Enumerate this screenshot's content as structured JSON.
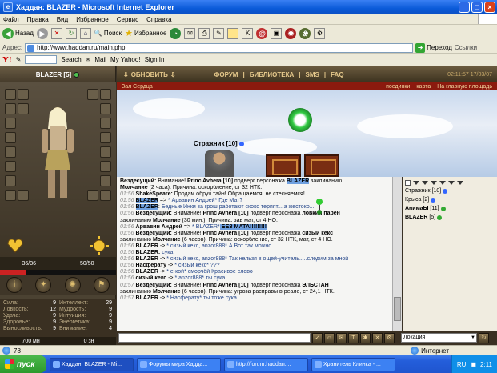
{
  "window": {
    "title": "Хаддан: BLAZER - Microsoft Internet Explorer"
  },
  "menu": [
    "Файл",
    "Правка",
    "Вид",
    "Избранное",
    "Сервис",
    "Справка"
  ],
  "toolbar": {
    "back": "Назад",
    "search": "Поиск",
    "favorites": "Избранное"
  },
  "address": {
    "label": "Адрес:",
    "url": "http://www.haddan.ru/main.php",
    "go": "Переход",
    "links": "Ссылки"
  },
  "yahoo": {
    "search": "Search",
    "mail": "Mail",
    "myyahoo": "My Yahoo!",
    "signin": "Sign In"
  },
  "game": {
    "player": {
      "name": "BLAZER [5]",
      "hp": "36/36",
      "mana": "50/50"
    },
    "nav": {
      "refresh": "ОБНОВИТЬ",
      "links": [
        "ФОРУМ",
        "БИБЛИОТЕКА",
        "SMS",
        "FAQ"
      ],
      "time": "02:11:57  17/03/07"
    },
    "location": {
      "title": "Зал Сердца",
      "links": [
        "поединки",
        "карта",
        "На главную площадь"
      ]
    },
    "enemy": {
      "name": "Стражник",
      "level": "[10]"
    },
    "stats_left": [
      {
        "label": "Сила:",
        "value": "9"
      },
      {
        "label": "Ловкость:",
        "value": "12"
      },
      {
        "label": "Удача:",
        "value": "9"
      },
      {
        "label": "Здоровье:",
        "value": "9"
      },
      {
        "label": "Выносливость:",
        "value": "9"
      }
    ],
    "stats_right": [
      {
        "label": "Интеллект:",
        "value": "29"
      },
      {
        "label": "Мудрость:",
        "value": "9"
      },
      {
        "label": "Интуиция:",
        "value": "9"
      },
      {
        "label": "Энергетика:",
        "value": "9"
      },
      {
        "label": "Внимание:",
        "value": "4"
      }
    ],
    "bottom": {
      "money": "700 мн",
      "zn": "0 зн"
    },
    "chat": [
      {
        "time": "",
        "parts": [
          {
            "c": "n",
            "t": "Вездесущий: "
          },
          {
            "c": "",
            "t": "Внимание! "
          },
          {
            "c": "n",
            "t": "Princ Avhera [10]"
          },
          {
            "c": "",
            "t": " подверг персонажа "
          },
          {
            "c": "h",
            "t": "BLAZER"
          },
          {
            "c": "",
            "t": " заклинанию"
          }
        ]
      },
      {
        "time": "",
        "parts": [
          {
            "c": "n",
            "t": "Молчание"
          },
          {
            "c": "",
            "t": " (2 часа). Причина: оскорбление, ст 32 НТК."
          }
        ]
      },
      {
        "time": "",
        "parts": [
          {
            "c": "",
            "t": " "
          }
        ]
      },
      {
        "time": "01:56",
        "parts": [
          {
            "c": "n",
            "t": "ShakeSpeare: "
          },
          {
            "c": "",
            "t": "Продам обруч тайн! Обращаемся, не стесняемся!"
          }
        ]
      },
      {
        "time": "01:56",
        "parts": [
          {
            "c": "h",
            "t": "BLAZER"
          },
          {
            "c": "",
            "t": " => "
          },
          {
            "c": "b",
            "t": "* Арвавин Андрей* Где Мат?"
          }
        ]
      },
      {
        "time": "01:56",
        "parts": [
          {
            "c": "h",
            "t": "BLAZER"
          },
          {
            "c": "",
            "t": ": "
          },
          {
            "c": "b",
            "t": "Бедные Инки за грош работают скоко терпят....а жестоко...."
          }
        ]
      },
      {
        "time": "01:56",
        "parts": [
          {
            "c": "n",
            "t": "Вездесущий: "
          },
          {
            "c": "",
            "t": "Внимание! "
          },
          {
            "c": "n",
            "t": "Princ Avhera [10]"
          },
          {
            "c": "",
            "t": " подверг персонажа "
          },
          {
            "c": "n",
            "t": "ловкий парен"
          }
        ]
      },
      {
        "time": "",
        "parts": [
          {
            "c": "",
            "t": "заклинанию "
          },
          {
            "c": "n",
            "t": "Молчание"
          },
          {
            "c": "",
            "t": " (30 мин.). Причина: зав мат, ст 4 НО."
          }
        ]
      },
      {
        "time": "01:56",
        "parts": [
          {
            "c": "n",
            "t": "Арвавин Андрей"
          },
          {
            "c": "",
            "t": " => "
          },
          {
            "c": "b",
            "t": "* BLAZER*"
          },
          {
            "c": "h",
            "t": " БЕЗ МАТА!!!!!!!!!"
          }
        ]
      },
      {
        "time": "01:56",
        "parts": [
          {
            "c": "n",
            "t": "Вездесущий: "
          },
          {
            "c": "",
            "t": "Внимание! "
          },
          {
            "c": "n",
            "t": "Princ Avhera [10]"
          },
          {
            "c": "",
            "t": " подверг персонажа "
          },
          {
            "c": "n",
            "t": "сизый кекс"
          }
        ]
      },
      {
        "time": "",
        "parts": [
          {
            "c": "",
            "t": "заклинанию "
          },
          {
            "c": "n",
            "t": "Молчание"
          },
          {
            "c": "",
            "t": " (6 часов). Причина: оскорбление, ст 32 НТК, мат, ст 4 НО."
          }
        ]
      },
      {
        "time": "01:56",
        "parts": [
          {
            "c": "n",
            "t": "BLAZER"
          },
          {
            "c": "",
            "t": " -> "
          },
          {
            "c": "b",
            "t": "* сизый кекс, anzor888* А Вот так можно"
          }
        ]
      },
      {
        "time": "01:56",
        "parts": [
          {
            "c": "n",
            "t": "BLAZER: "
          },
          {
            "c": "b",
            "t": "сука"
          }
        ]
      },
      {
        "time": "01:56",
        "parts": [
          {
            "c": "n",
            "t": "BLAZER"
          },
          {
            "c": "",
            "t": " -> "
          },
          {
            "c": "b",
            "t": "* сизый кекс, anzor888* Так нельзя в ощей-учитель.....следим за мной"
          }
        ]
      },
      {
        "time": "01:56",
        "parts": [
          {
            "c": "n",
            "t": "Насферату"
          },
          {
            "c": "",
            "t": " -> "
          },
          {
            "c": "b",
            "t": "* сизый кекс* ???"
          }
        ]
      },
      {
        "time": "01:56",
        "parts": [
          {
            "c": "n",
            "t": "BLAZER"
          },
          {
            "c": "",
            "t": " -> "
          },
          {
            "c": "b",
            "t": "* е-кой* сморчёй Красивое слово"
          }
        ]
      },
      {
        "time": "01:56",
        "parts": [
          {
            "c": "n",
            "t": "сизый кекс"
          },
          {
            "c": "",
            "t": " -> "
          },
          {
            "c": "b",
            "t": "* anzor888* ты сука"
          }
        ]
      },
      {
        "time": "01:57",
        "parts": [
          {
            "c": "n",
            "t": "Вездесущий: "
          },
          {
            "c": "",
            "t": "Внимание! "
          },
          {
            "c": "n",
            "t": "Princ Avhera [10]"
          },
          {
            "c": "",
            "t": " подверг персонажа "
          },
          {
            "c": "n",
            "t": "ЭЛЬСТАН"
          }
        ]
      },
      {
        "time": "",
        "parts": [
          {
            "c": "",
            "t": "заклинанию "
          },
          {
            "c": "n",
            "t": "Молчание"
          },
          {
            "c": "",
            "t": " (6 часов). Причина: угроза расправы в реале, ст 24,1 НТК."
          }
        ]
      },
      {
        "time": "01:57",
        "parts": [
          {
            "c": "n",
            "t": "BLAZER"
          },
          {
            "c": "",
            "t": " -> "
          },
          {
            "c": "b",
            "t": "* Насферату* ты тоже сука"
          }
        ]
      }
    ],
    "players": [
      {
        "name": "Стражник",
        "level": "[10]",
        "dot": "blue"
      },
      {
        "name": "Крыса",
        "level": "[2]",
        "dot": "blue"
      },
      {
        "name": "АнимаЫ",
        "level": "[11]",
        "dot": "green"
      },
      {
        "name": "BLAZER",
        "level": "[5]",
        "dot": "green"
      }
    ],
    "location_select": "Локация"
  },
  "status": {
    "progress": "78",
    "zone": "Интернет"
  },
  "taskbar": {
    "start": "пуск",
    "tasks": [
      "Хаддан: BLAZER - Mi...",
      "Форумы мира Хадда...",
      "http://forum.haddan....",
      "Хранитель Клинка - ..."
    ],
    "lang": "RU",
    "clock": "2:11"
  }
}
